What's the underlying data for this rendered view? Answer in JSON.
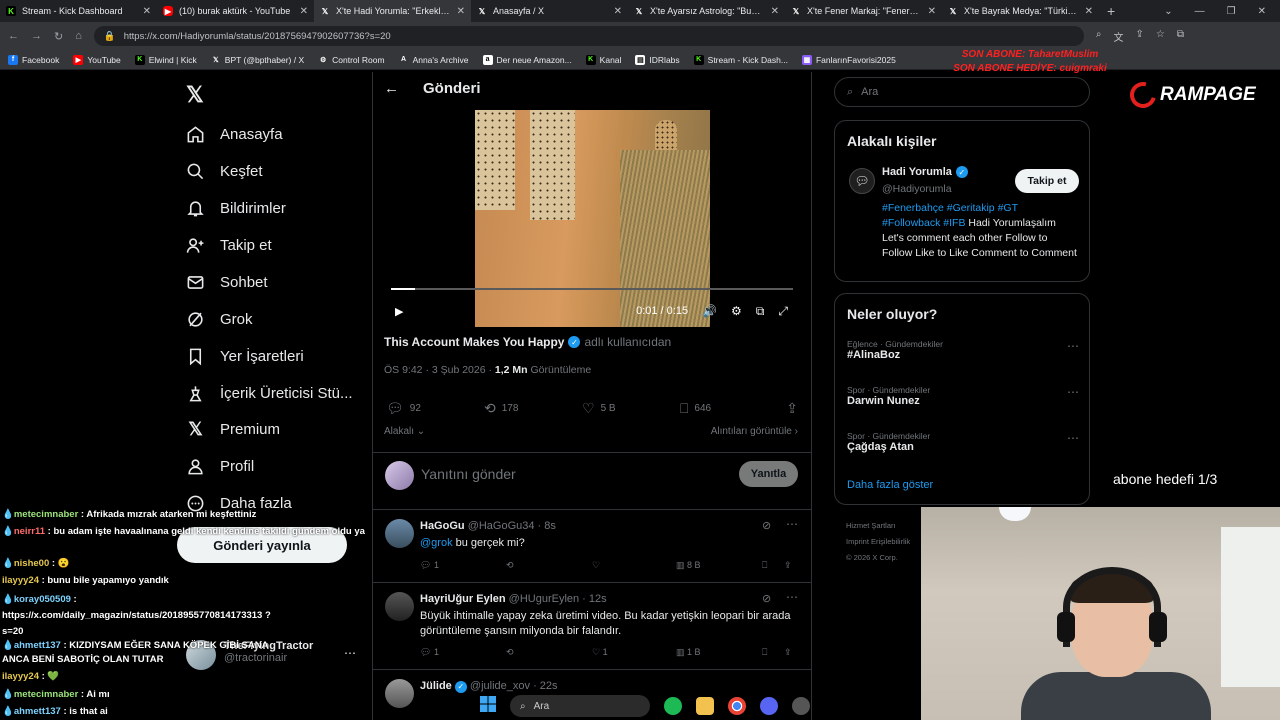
{
  "browser": {
    "tabs": [
      {
        "title": "Stream - Kick Dashboard",
        "icon": "kick-icon"
      },
      {
        "title": "(10) burak aktürk - YouTube",
        "icon": "youtube-icon"
      },
      {
        "title": "X'te Hadi Yorumla: \"Erkekler ne...",
        "icon": "x-icon",
        "active": true
      },
      {
        "title": "Anasayfa / X",
        "icon": "x-icon"
      },
      {
        "title": "X'te Ayarsız Astrolog: \"Bugünü...",
        "icon": "x-icon"
      },
      {
        "title": "X'te Fener Markaj: \"Fenerbahçe...",
        "icon": "x-icon"
      },
      {
        "title": "X'te Bayrak Medya: \"Türkiye'de...",
        "icon": "x-icon"
      }
    ],
    "url": "https://x.com/Hadiyorumla/status/2018756947902607736?s=20",
    "bookmarks": [
      "Facebook",
      "YouTube",
      "Elwind | Kick",
      "BPT (@bpthaber) / X",
      "Control Room",
      "Anna's Archive",
      "Der neue Amazon...",
      "Kanal",
      "IDRlabs",
      "Stream - Kick Dash...",
      "FanlarınFavorisi2025"
    ]
  },
  "overlay": {
    "sub_line1": "SON ABONE: TaharetMuslim",
    "sub_line2": "SON ABONE HEDİYE: cuigmraki",
    "brand": "RAMPAGE",
    "goal": "abone hedefi 1/3"
  },
  "nav": {
    "items": [
      "Anasayfa",
      "Keşfet",
      "Bildirimler",
      "Takip et",
      "Sohbet",
      "Grok",
      "Yer İşaretleri",
      "İçerik Üreticisi Stü...",
      "Premium",
      "Profil",
      "Daha fazla"
    ],
    "post_button": "Gönderi yayınla"
  },
  "post": {
    "header": "Gönderi",
    "video_time": "0:01 / 0:15",
    "video_progress": 0.06,
    "author": "This Account Makes You Happy",
    "author_suffix": "adlı kullanıcıdan",
    "time": "ÖS 9:42 · 3 Şub 2026 ·",
    "views": "1,2 Mn",
    "views_label": "Görüntüleme",
    "replies": "92",
    "reposts": "178",
    "likes": "5 B",
    "bookmarks": "646",
    "relevance": "Alakalı",
    "quotes": "Alıntıları görüntüle"
  },
  "reply_box": {
    "placeholder": "Yanıtını gönder",
    "button": "Yanıtla"
  },
  "replies": [
    {
      "name": "HaGoGu",
      "handle": "@HaGoGu34 · 8s",
      "mention": "@grok",
      "text": "bu gerçek mi?",
      "replies": "1",
      "likes": "",
      "views": "8 B"
    },
    {
      "name": "HayriUğur Eylen",
      "handle": "@HUgurEylen · 12s",
      "text": "Büyük ihtimalle yapay zeka üretimi video. Bu kadar yetişkin leopari bir arada görüntüleme şansın milyonda bir falandır.",
      "replies": "1",
      "likes": "1",
      "views": "1 B"
    },
    {
      "name": "Jülide",
      "handle": "@julide_xov · 22s"
    }
  ],
  "right": {
    "search_placeholder": "Ara",
    "related_title": "Alakalı kişiler",
    "person_name": "Hadi Yorumla",
    "person_handle": "@Hadiyorumla",
    "follow": "Takip et",
    "bio_tags": "#Fenerbahçe #Geritakip #GT #Followback #IFB",
    "bio_text": "Hadi Yorumlaşalım Let's comment each other Follow to Follow Like to Like Comment to Comment",
    "trends_title": "Neler oluyor?",
    "trends": [
      {
        "cat": "Eğlence · Gündemdekiler",
        "name": "#AlinaBoz"
      },
      {
        "cat": "Spor · Gündemdekiler",
        "name": "Darwin Nunez"
      },
      {
        "cat": "Spor · Gündemdekiler",
        "name": "Çağdaş Atan"
      }
    ],
    "more": "Daha fazla göster",
    "footer1": "Hizmet Şartları",
    "footer2": "Imprint   Erişilebilirlik",
    "footer3": "© 2026 X Corp."
  },
  "account_switch": {
    "name": "TheFlyingTractor",
    "handle": "@tractorinair"
  },
  "chat": [
    {
      "user": "metecimnaber",
      "msg": ": Afrikada mızrak atarken mi keşfettiniz"
    },
    {
      "user": "neirr11",
      "msg": ": bu adam işte havaalınana geldi kendi kendine takıldı gündem oldu ya"
    },
    {
      "user": "nishe00",
      "msg": ": 😮"
    },
    {
      "user": "ilayyy24",
      "msg": ": bunu bile yapamıyo yandık"
    },
    {
      "user": "koray050509",
      "msg": ": https://x.com/daily_magazin/status/2018955770814173313 ?s=20"
    },
    {
      "user": "ahmett137",
      "msg": ": KIZDIYSAM EĞER SANA KÖPEK GİBİ SANA ANCA BENİ SABOTİÇ OLAN TUTAR"
    },
    {
      "user": "ilayyy24",
      "msg": ": 💚"
    },
    {
      "user": "metecimnaber",
      "msg": ": Ai mı"
    },
    {
      "user": "ahmett137",
      "msg": ": is that ai"
    }
  ],
  "taskbar": {
    "search": "Ara"
  }
}
